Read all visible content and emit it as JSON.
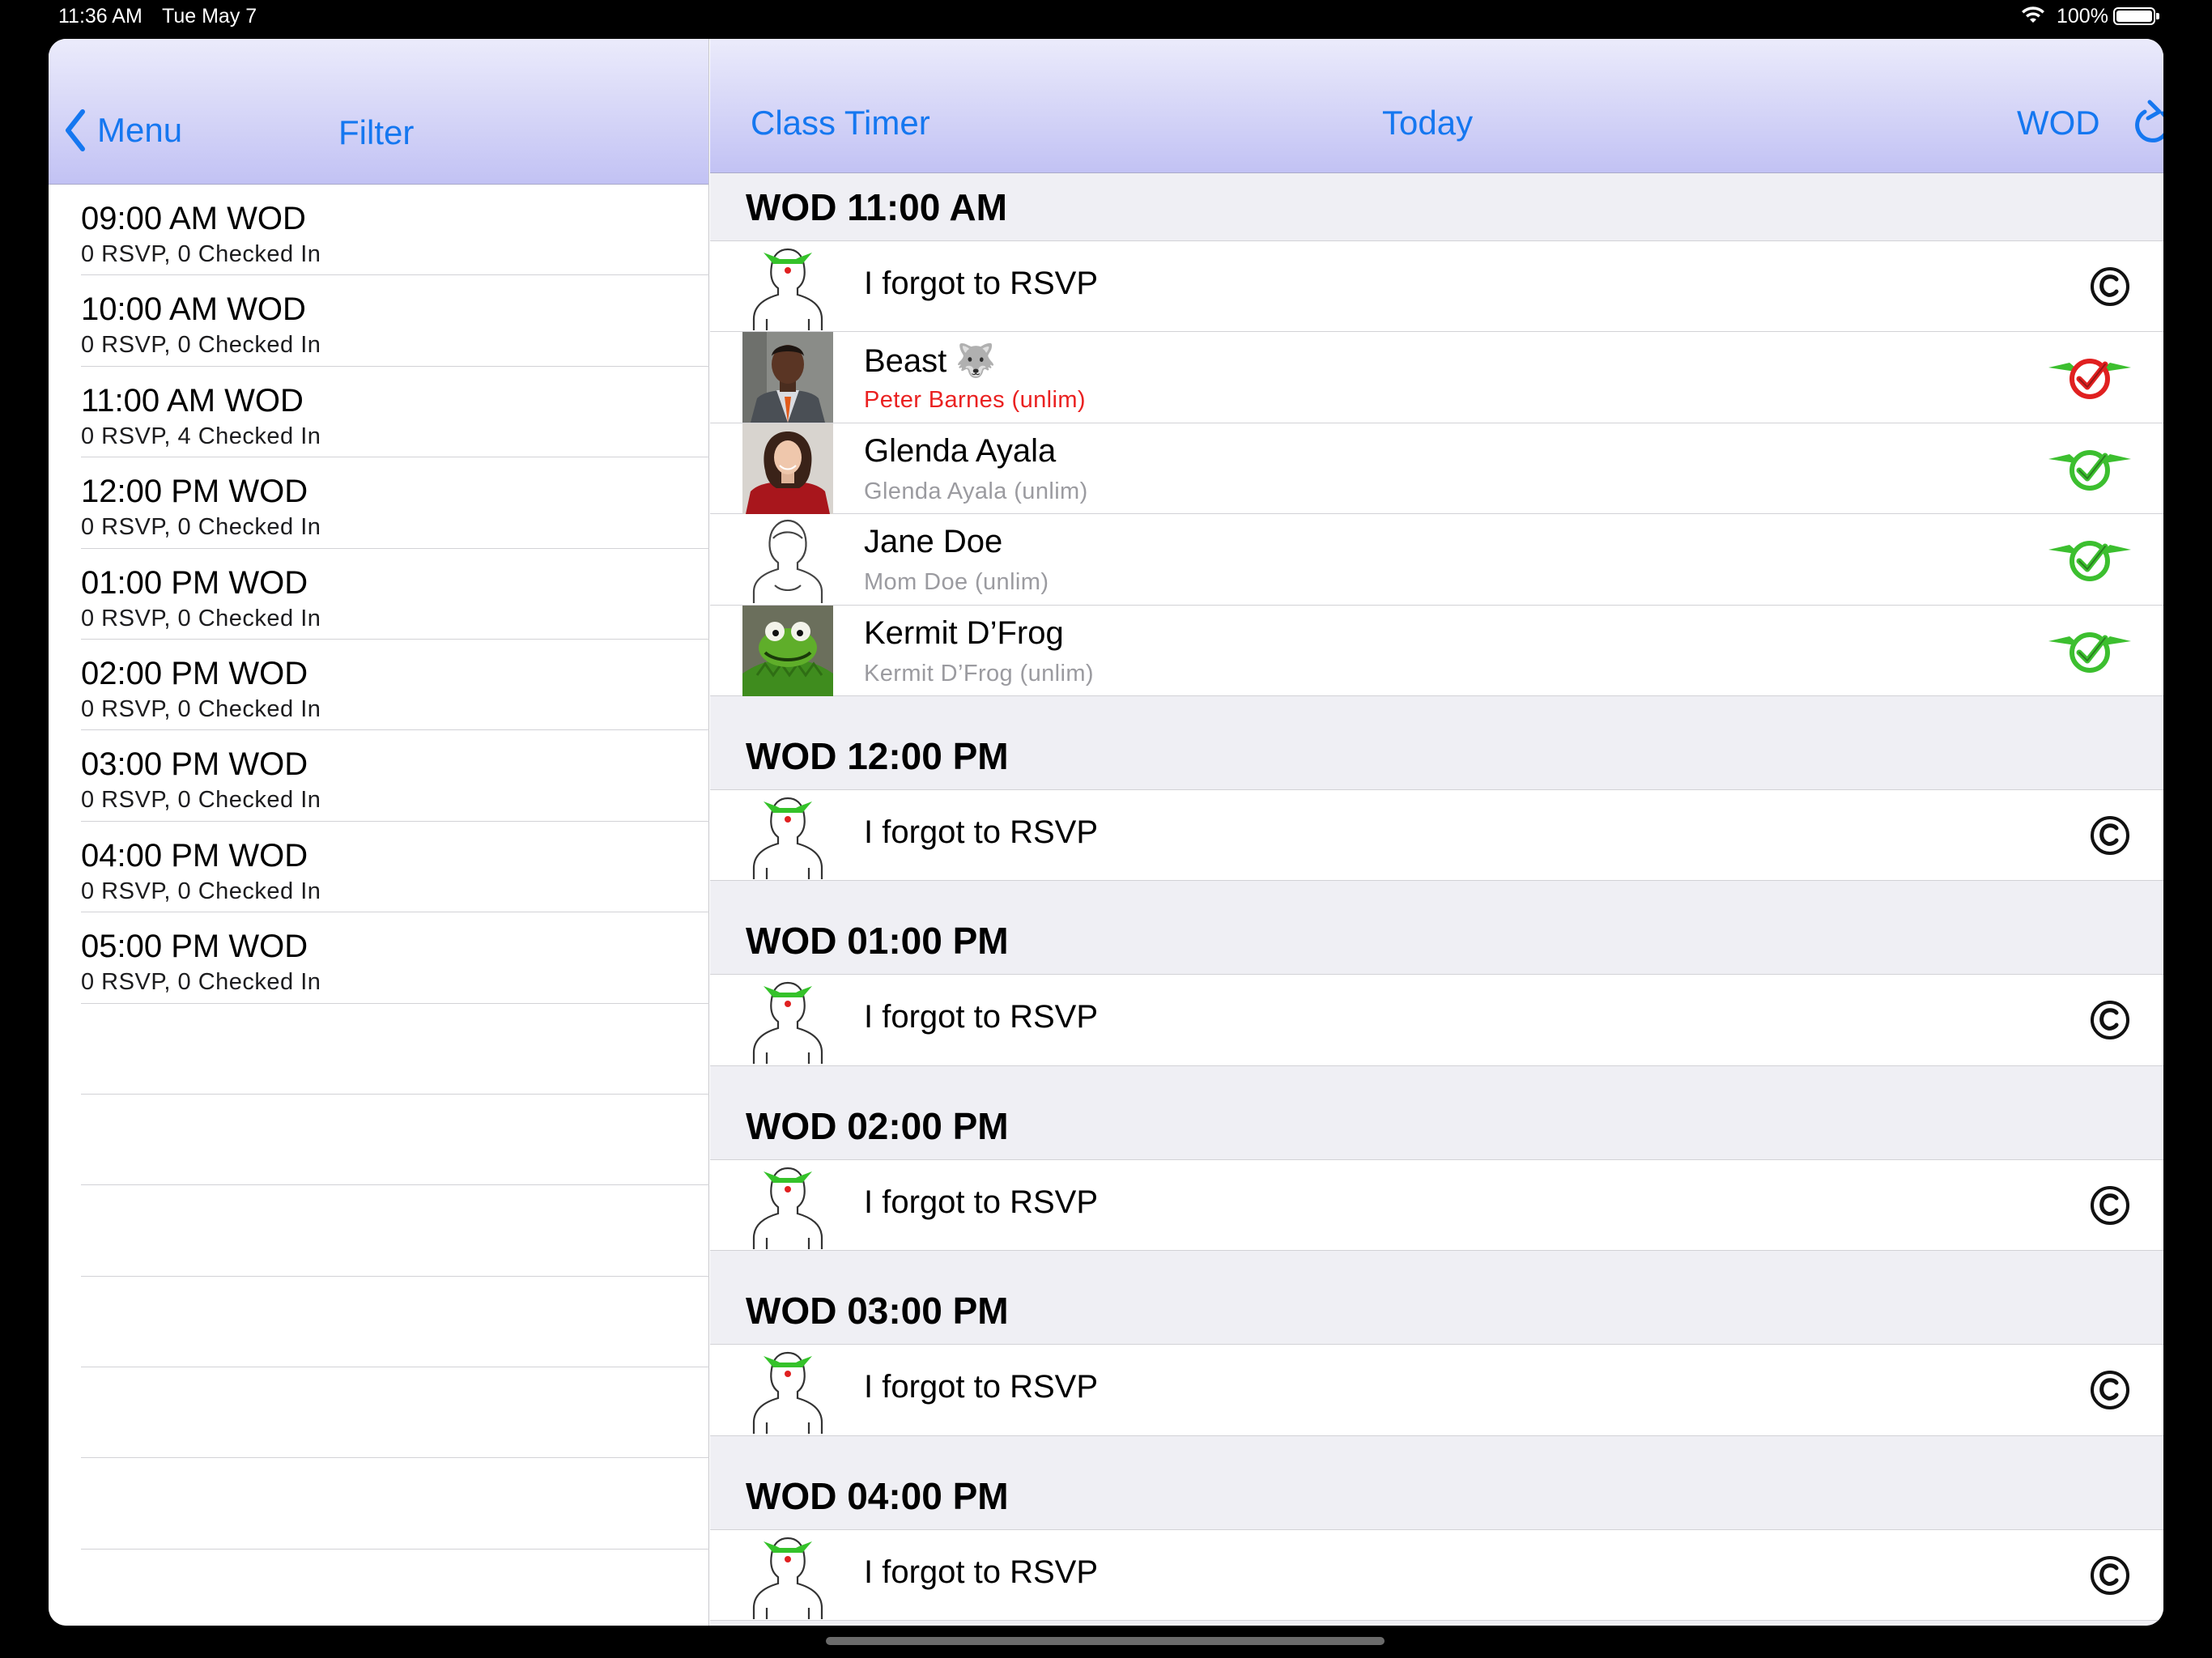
{
  "status_bar": {
    "time": "11:36 AM",
    "date": "Tue May 7",
    "battery_percent": "100%"
  },
  "colors": {
    "accent": "#1577f0",
    "nav_gradient_top": "#ebebfb",
    "nav_gradient_bottom": "#c2c2f4",
    "checkin_green": "#3cbf2f",
    "checkin_red": "#e02020",
    "alert_text": "#ea2121"
  },
  "master_nav": {
    "back_label": "Menu",
    "filter_label": "Filter"
  },
  "classes": [
    {
      "title": "09:00 AM WOD",
      "sub": "0 RSVP, 0 Checked In"
    },
    {
      "title": "10:00 AM WOD",
      "sub": "0 RSVP, 0 Checked In"
    },
    {
      "title": "11:00 AM WOD",
      "sub": "0 RSVP, 4 Checked In"
    },
    {
      "title": "12:00 PM WOD",
      "sub": "0 RSVP, 0 Checked In"
    },
    {
      "title": "01:00 PM WOD",
      "sub": "0 RSVP, 0 Checked In"
    },
    {
      "title": "02:00 PM WOD",
      "sub": "0 RSVP, 0 Checked In"
    },
    {
      "title": "03:00 PM WOD",
      "sub": "0 RSVP, 0 Checked In"
    },
    {
      "title": "04:00 PM WOD",
      "sub": "0 RSVP, 0 Checked In"
    },
    {
      "title": "05:00 PM WOD",
      "sub": "0 RSVP, 0 Checked In"
    }
  ],
  "detail_nav": {
    "class_timer_label": "Class Timer",
    "today_label": "Today",
    "wod_label": "WOD",
    "refresh_icon": "refresh-icon"
  },
  "sections": [
    {
      "header": "WOD 11:00 AM",
      "rows": [
        {
          "name": "I forgot to RSVP",
          "plan": "",
          "avatar": "forgot-avatar",
          "status": "c-icon"
        },
        {
          "name": "Beast 🐺",
          "plan": "Peter Barnes (unlim)",
          "plan_alert": true,
          "avatar": "man-photo",
          "status": "red-check"
        },
        {
          "name": "Glenda Ayala",
          "plan": "Glenda Ayala (unlim)",
          "avatar": "woman-photo",
          "status": "green-check"
        },
        {
          "name": "Jane Doe",
          "plan": "Mom Doe (unlim)",
          "avatar": "female-outline",
          "status": "green-check"
        },
        {
          "name": "Kermit D’Frog",
          "plan": "Kermit D’Frog (unlim)",
          "avatar": "frog-photo",
          "status": "green-check"
        }
      ]
    },
    {
      "header": "WOD 12:00 PM",
      "rows": [
        {
          "name": "I forgot to RSVP",
          "plan": "",
          "avatar": "forgot-avatar",
          "status": "c-icon"
        }
      ]
    },
    {
      "header": "WOD 01:00 PM",
      "rows": [
        {
          "name": "I forgot to RSVP",
          "plan": "",
          "avatar": "forgot-avatar",
          "status": "c-icon"
        }
      ]
    },
    {
      "header": "WOD 02:00 PM",
      "rows": [
        {
          "name": "I forgot to RSVP",
          "plan": "",
          "avatar": "forgot-avatar",
          "status": "c-icon"
        }
      ]
    },
    {
      "header": "WOD 03:00 PM",
      "rows": [
        {
          "name": "I forgot to RSVP",
          "plan": "",
          "avatar": "forgot-avatar",
          "status": "c-icon"
        }
      ]
    },
    {
      "header": "WOD 04:00 PM",
      "rows": [
        {
          "name": "I forgot to RSVP",
          "plan": "",
          "avatar": "forgot-avatar",
          "status": "c-icon"
        }
      ]
    }
  ]
}
